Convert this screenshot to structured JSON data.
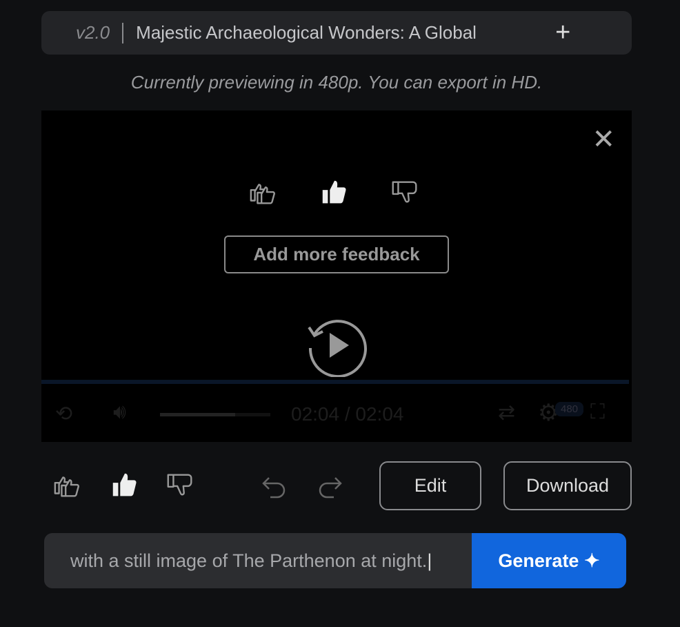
{
  "tab": {
    "version": "v2.0",
    "title": "Majestic Archaeological Wonders: A Global",
    "add_icon": "plus-icon"
  },
  "notice": "Currently previewing in 480p. You can export in HD.",
  "player": {
    "feedback_button": "Add more feedback",
    "time": "02:04 / 02:04",
    "quality": "480",
    "progress": 1.0,
    "volume": 0.68
  },
  "actions": {
    "edit": "Edit",
    "download": "Download"
  },
  "prompt": {
    "value": "with a still image of The Parthenon at night.",
    "generate": "Generate"
  },
  "colors": {
    "accent": "#1166dd",
    "background": "#0f1012"
  }
}
